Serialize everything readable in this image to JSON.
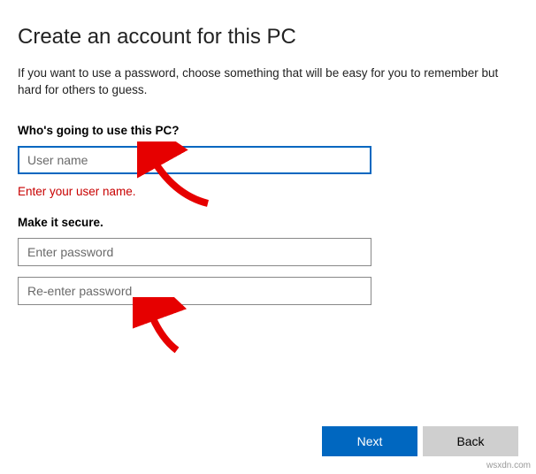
{
  "title": "Create an account for this PC",
  "subtitle": "If you want to use a password, choose something that will be easy for you to remember but hard for others to guess.",
  "section_user": {
    "label": "Who's going to use this PC?",
    "placeholder": "User name",
    "value": "",
    "error": "Enter your user name."
  },
  "section_password": {
    "label": "Make it secure.",
    "password_placeholder": "Enter password",
    "password_value": "",
    "reenter_placeholder": "Re-enter password",
    "reenter_value": ""
  },
  "buttons": {
    "next": "Next",
    "back": "Back"
  },
  "watermark": "wsxdn.com"
}
